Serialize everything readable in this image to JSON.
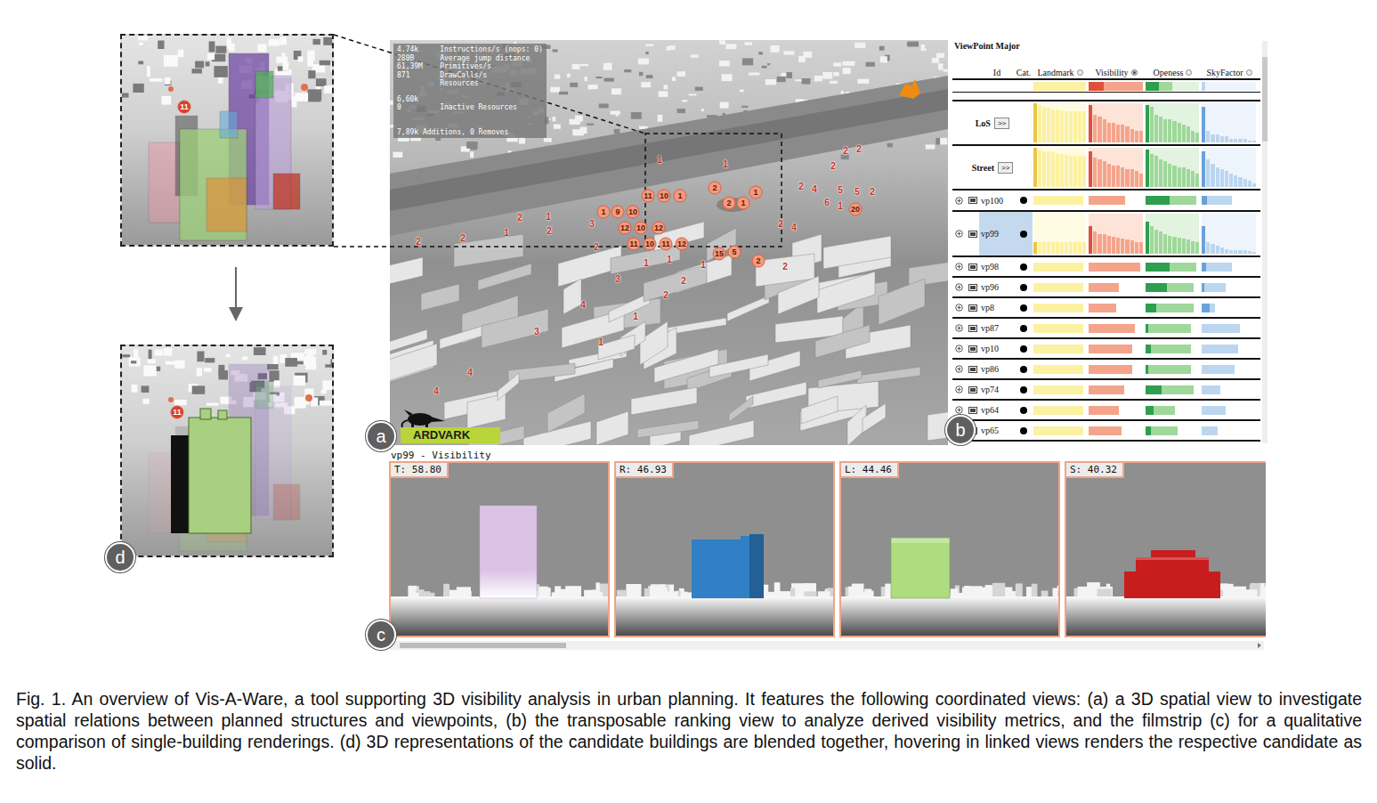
{
  "insets": [
    {
      "pins": [
        "11"
      ]
    },
    {
      "badge": "d",
      "pins": [
        "11"
      ]
    }
  ],
  "spatial_view": {
    "badge": "a",
    "logo": "ARDVARK",
    "stats": [
      "4.74k     Instructions/s (nops: 0)",
      "280B      Average jump distance",
      "61,39M    Primitives/s",
      "871       DrawCalls/s",
      "          Resources",
      "6,60k",
      "0         Inactive Resources",
      "7,89k Additions, 0 Removes"
    ],
    "pins": [
      {
        "text": "11",
        "kind": "bubble"
      },
      {
        "text": "10",
        "kind": "bubble"
      },
      {
        "text": "1",
        "kind": "bubble"
      },
      {
        "text": "2",
        "kind": "bubble"
      },
      {
        "text": "2",
        "kind": "bubble"
      },
      {
        "text": "1",
        "kind": "bubble"
      },
      {
        "text": "1",
        "kind": "bubble"
      },
      {
        "text": "1",
        "kind": "bubble"
      },
      {
        "text": "9",
        "kind": "bubble"
      },
      {
        "text": "10",
        "kind": "bubble"
      },
      {
        "text": "12",
        "kind": "bubble"
      },
      {
        "text": "10",
        "kind": "bubble"
      },
      {
        "text": "12",
        "kind": "bubble"
      },
      {
        "text": "11",
        "kind": "bubble"
      },
      {
        "text": "10",
        "kind": "bubble"
      },
      {
        "text": "11",
        "kind": "bubble"
      },
      {
        "text": "12",
        "kind": "bubble"
      },
      {
        "text": "15",
        "kind": "bubble"
      },
      {
        "text": "5",
        "kind": "bubble"
      },
      {
        "text": "2",
        "kind": "bubble"
      },
      {
        "text": "20",
        "kind": "bubble"
      },
      {
        "text": "2",
        "kind": "tag"
      },
      {
        "text": "2",
        "kind": "tag"
      },
      {
        "text": "1",
        "kind": "tag"
      },
      {
        "text": "2",
        "kind": "tag"
      },
      {
        "text": "2",
        "kind": "tag"
      },
      {
        "text": "1",
        "kind": "tag"
      },
      {
        "text": "3",
        "kind": "tag"
      },
      {
        "text": "2",
        "kind": "tag"
      },
      {
        "text": "1",
        "kind": "tag"
      },
      {
        "text": "1",
        "kind": "tag"
      },
      {
        "text": "1",
        "kind": "tag"
      },
      {
        "text": "2",
        "kind": "tag"
      },
      {
        "text": "3",
        "kind": "tag"
      },
      {
        "text": "2",
        "kind": "tag"
      },
      {
        "text": "2",
        "kind": "tag"
      },
      {
        "text": "4",
        "kind": "tag"
      },
      {
        "text": "1",
        "kind": "tag"
      },
      {
        "text": "3",
        "kind": "tag"
      },
      {
        "text": "1",
        "kind": "tag"
      },
      {
        "text": "4",
        "kind": "tag"
      },
      {
        "text": "4",
        "kind": "tag"
      },
      {
        "text": "2",
        "kind": "tag"
      },
      {
        "text": "4",
        "kind": "tag"
      },
      {
        "text": "5",
        "kind": "tag"
      },
      {
        "text": "6",
        "kind": "tag"
      },
      {
        "text": "1",
        "kind": "tag"
      },
      {
        "text": "5",
        "kind": "tag"
      },
      {
        "text": "2",
        "kind": "tag"
      },
      {
        "text": "4",
        "kind": "tag"
      },
      {
        "text": "2",
        "kind": "tag"
      },
      {
        "text": "2",
        "kind": "tag"
      },
      {
        "text": "2",
        "kind": "tag"
      },
      {
        "text": "2",
        "kind": "tag"
      },
      {
        "text": "1",
        "kind": "tag"
      },
      {
        "text": "1",
        "kind": "tag"
      }
    ]
  },
  "ranking": {
    "badge": "b",
    "title": "ViewPoint Major",
    "columns": [
      "Id",
      "Cat."
    ],
    "metrics": [
      {
        "label": "Landmark",
        "selected": false
      },
      {
        "label": "Visibility",
        "selected": true
      },
      {
        "label": "Openess",
        "selected": false
      },
      {
        "label": "SkyFactor",
        "selected": false
      }
    ],
    "scrollbar_level": 0.21,
    "summary": [
      {
        "kind": "bar",
        "level": 1,
        "accent": 0
      },
      {
        "kind": "bar",
        "level": 1,
        "accent": 0.28
      },
      {
        "kind": "bar",
        "level": 0.5,
        "accent": 0.25
      },
      {
        "kind": "bar",
        "level": 0.06,
        "accent": 0
      }
    ],
    "groups": [
      {
        "label": "LoS",
        "button": ">>",
        "cells": [
          {
            "kind": "histogram",
            "values": [
              1,
              0.95,
              0.9,
              0.88,
              0.85,
              0.85,
              0.82,
              0.8,
              0.8,
              0.8,
              0.8,
              0.8
            ]
          },
          {
            "kind": "histogram",
            "values": [
              0.95,
              0.7,
              0.65,
              0.6,
              0.5,
              0.5,
              0.45,
              0.45,
              0.4,
              0.35,
              0.3,
              0.3
            ]
          },
          {
            "kind": "histogram",
            "values": [
              0.95,
              0.9,
              0.7,
              0.65,
              0.6,
              0.6,
              0.55,
              0.5,
              0.45,
              0.4,
              0.3,
              0.25
            ]
          },
          {
            "kind": "histogram",
            "values": [
              0.9,
              0.3,
              0.2,
              0.2,
              0.15,
              0.15,
              0.1,
              0.1,
              0.1,
              0.1,
              0.05,
              0.05
            ]
          }
        ]
      },
      {
        "label": "Street",
        "button": ">>",
        "cells": [
          {
            "kind": "histogram",
            "values": [
              1,
              0.95,
              0.92,
              0.9,
              0.88,
              0.85,
              0.85,
              0.82,
              0.8,
              0.8,
              0.8,
              0.8
            ]
          },
          {
            "kind": "histogram",
            "values": [
              0.9,
              0.75,
              0.7,
              0.65,
              0.6,
              0.55,
              0.55,
              0.5,
              0.45,
              0.45,
              0.4,
              0.35
            ]
          },
          {
            "kind": "histogram",
            "values": [
              0.95,
              0.85,
              0.8,
              0.7,
              0.65,
              0.6,
              0.55,
              0.5,
              0.5,
              0.45,
              0.4,
              0.35
            ]
          },
          {
            "kind": "histogram",
            "values": [
              0.9,
              0.7,
              0.6,
              0.5,
              0.45,
              0.4,
              0.35,
              0.3,
              0.25,
              0.2,
              0.15,
              0.1
            ]
          }
        ]
      }
    ],
    "rows": [
      {
        "id": "vp100",
        "selected": false,
        "cells": [
          {
            "kind": "bar",
            "level": 0.95,
            "accent": 0
          },
          {
            "kind": "bar",
            "level": 0.68,
            "accent": 0
          },
          {
            "kind": "bar",
            "level": 0.95,
            "accent": 0.45
          },
          {
            "kind": "bar",
            "level": 0.55,
            "accent": 0.1
          }
        ]
      },
      {
        "id": "vp99",
        "selected": true,
        "cells": [
          {
            "kind": "histogram",
            "values": [
              0.3,
              0.3,
              0.3,
              0.3,
              0.3,
              0.3,
              0.3,
              0.3,
              0.3,
              0.3,
              0.3,
              0.3
            ]
          },
          {
            "kind": "histogram",
            "values": [
              0.7,
              0.55,
              0.5,
              0.48,
              0.45,
              0.42,
              0.4,
              0.38,
              0.36,
              0.34,
              0.3,
              0.28
            ]
          },
          {
            "kind": "histogram",
            "values": [
              0.8,
              0.7,
              0.6,
              0.55,
              0.5,
              0.45,
              0.42,
              0.4,
              0.38,
              0.35,
              0.32,
              0.3
            ]
          },
          {
            "kind": "histogram",
            "values": [
              0.7,
              0.3,
              0.25,
              0.2,
              0.15,
              0.12,
              0.1,
              0.1,
              0.08,
              0.08,
              0.06,
              0.05
            ]
          }
        ]
      },
      {
        "id": "vp98",
        "selected": false,
        "cells": [
          {
            "kind": "bar",
            "level": 0.95,
            "accent": 0
          },
          {
            "kind": "bar",
            "level": 0.95,
            "accent": 0
          },
          {
            "kind": "bar",
            "level": 0.95,
            "accent": 0.45
          },
          {
            "kind": "bar",
            "level": 0.55,
            "accent": 0.08
          }
        ]
      },
      {
        "id": "vp96",
        "selected": false,
        "cells": [
          {
            "kind": "bar",
            "level": 0.95,
            "accent": 0
          },
          {
            "kind": "bar",
            "level": 0.55,
            "accent": 0
          },
          {
            "kind": "bar",
            "level": 0.9,
            "accent": 0.4
          },
          {
            "kind": "bar",
            "level": 0.45,
            "accent": 0.05
          }
        ]
      },
      {
        "id": "vp8",
        "selected": false,
        "cells": [
          {
            "kind": "bar",
            "level": 0.95,
            "accent": 0
          },
          {
            "kind": "bar",
            "level": 0.5,
            "accent": 0
          },
          {
            "kind": "bar",
            "level": 0.9,
            "accent": 0.2
          },
          {
            "kind": "bar",
            "level": 0.25,
            "accent": 0.15
          }
        ]
      },
      {
        "id": "vp87",
        "selected": false,
        "cells": [
          {
            "kind": "bar",
            "level": 0.95,
            "accent": 0
          },
          {
            "kind": "bar",
            "level": 0.85,
            "accent": 0
          },
          {
            "kind": "bar",
            "level": 0.85,
            "accent": 0.05
          },
          {
            "kind": "bar",
            "level": 0.7,
            "accent": 0
          }
        ]
      },
      {
        "id": "vp10",
        "selected": false,
        "cells": [
          {
            "kind": "bar",
            "level": 0.95,
            "accent": 0
          },
          {
            "kind": "bar",
            "level": 0.8,
            "accent": 0
          },
          {
            "kind": "bar",
            "level": 0.85,
            "accent": 0.1
          },
          {
            "kind": "bar",
            "level": 0.68,
            "accent": 0
          }
        ]
      },
      {
        "id": "vp86",
        "selected": false,
        "cells": [
          {
            "kind": "bar",
            "level": 0.95,
            "accent": 0
          },
          {
            "kind": "bar",
            "level": 0.8,
            "accent": 0
          },
          {
            "kind": "bar",
            "level": 0.85,
            "accent": 0.05
          },
          {
            "kind": "bar",
            "level": 0.6,
            "accent": 0
          }
        ]
      },
      {
        "id": "vp74",
        "selected": false,
        "cells": [
          {
            "kind": "bar",
            "level": 0.95,
            "accent": 0
          },
          {
            "kind": "bar",
            "level": 0.65,
            "accent": 0
          },
          {
            "kind": "bar",
            "level": 0.9,
            "accent": 0.3
          },
          {
            "kind": "bar",
            "level": 0.35,
            "accent": 0
          }
        ]
      },
      {
        "id": "vp64",
        "selected": false,
        "cells": [
          {
            "kind": "bar",
            "level": 0.95,
            "accent": 0
          },
          {
            "kind": "bar",
            "level": 0.55,
            "accent": 0
          },
          {
            "kind": "bar",
            "level": 0.55,
            "accent": 0.15
          },
          {
            "kind": "bar",
            "level": 0.45,
            "accent": 0
          }
        ]
      },
      {
        "id": "vp65",
        "selected": false,
        "cells": [
          {
            "kind": "bar",
            "level": 0.95,
            "accent": 0
          },
          {
            "kind": "bar",
            "level": 0.6,
            "accent": 0
          },
          {
            "kind": "bar",
            "level": 0.6,
            "accent": 0.1
          },
          {
            "kind": "bar",
            "level": 0.3,
            "accent": 0
          }
        ]
      }
    ]
  },
  "filmstrip": {
    "badge": "c",
    "title": "vp99 - Visibility",
    "scrollbar_level": 0.19,
    "frames": [
      {
        "label": "T: 58.80",
        "color": "#dcc3e6"
      },
      {
        "label": "R: 46.93",
        "color": "#2f80c4"
      },
      {
        "label": "L: 44.46",
        "color": "#aedc7e"
      },
      {
        "label": "S: 40.32",
        "color": "#c71d1d"
      }
    ]
  },
  "caption": "Fig. 1. An overview of Vis-A-Ware, a tool supporting 3D visibility analysis in urban planning. It features the following coordinated views: (a) a 3D spatial view to investigate spatial relations between planned structures and viewpoints, (b) the transposable ranking view to analyze derived visibility metrics, and the filmstrip (c) for a qualitative comparison of single-building renderings. (d) 3D representations of the candidate buildings are blended together, hovering in linked views renders the respective candidate as solid."
}
